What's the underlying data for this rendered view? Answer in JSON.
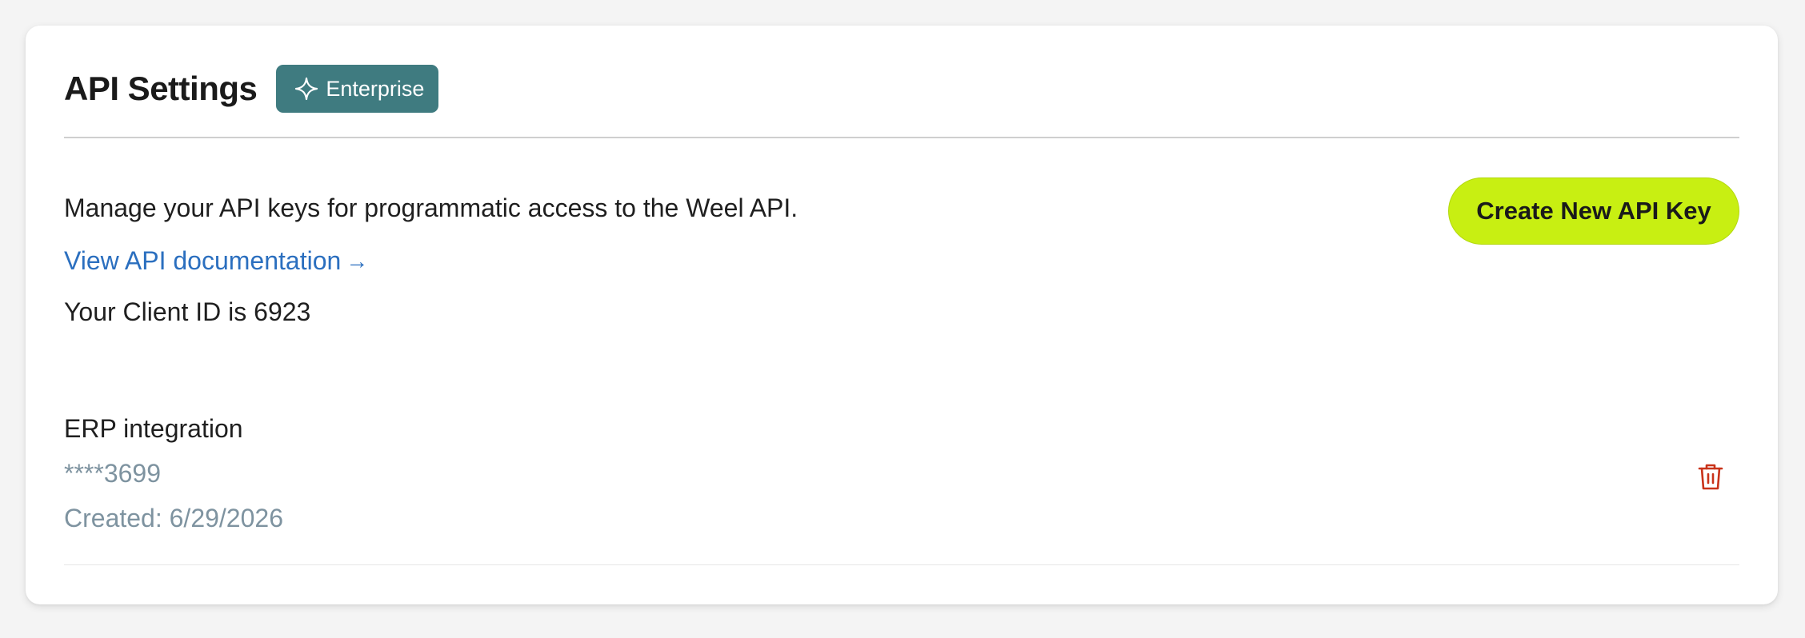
{
  "header": {
    "title": "API Settings",
    "badge_label": "Enterprise",
    "badge_icon": "sparkle-icon",
    "badge_color": "#3f7b80"
  },
  "intro": {
    "description": "Manage your API keys for programmatic access to the Weel API.",
    "doc_link_label": "View API documentation",
    "doc_link_arrow": "→",
    "client_id_text": "Your Client ID is 6923"
  },
  "actions": {
    "create_label": "Create New API Key",
    "create_color": "#c8ef12"
  },
  "keys": [
    {
      "name": "ERP integration",
      "masked": "****3699",
      "created": "Created: 6/29/2026",
      "delete_icon": "trash-icon",
      "delete_color": "#c9331a"
    }
  ],
  "colors": {
    "link": "#2b6fbf",
    "muted": "#7e93a0"
  }
}
